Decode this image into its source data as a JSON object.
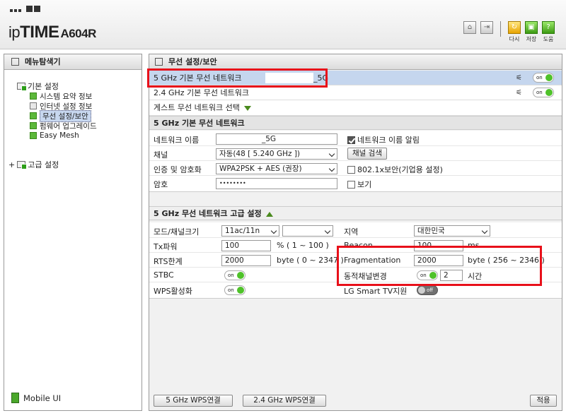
{
  "header": {
    "brand_ip": "ip",
    "brand_time": "TIME",
    "brand_model": "A604R",
    "icons": [
      {
        "name": "home-icon",
        "glyph": "⌂"
      },
      {
        "name": "logout-icon",
        "glyph": "⇥"
      }
    ],
    "actions": [
      {
        "name": "restart-button",
        "label": "다시",
        "glyph": "↻",
        "color": "#e8a400"
      },
      {
        "name": "save-button",
        "label": "저장",
        "glyph": "▣",
        "color": "#3c9b12"
      },
      {
        "name": "help-button",
        "label": "도움",
        "glyph": "?",
        "color": "#3c9b12"
      }
    ]
  },
  "sidebar": {
    "title": "메뉴탐색기",
    "basic_label": "기본 설정",
    "basic_items": [
      {
        "label": "시스템 요약 정보"
      },
      {
        "label": "인터넷 설정 정보"
      },
      {
        "label": "무선 설정/보안"
      },
      {
        "label": "펌웨어 업그레이드"
      },
      {
        "label": "Easy Mesh"
      }
    ],
    "advanced_label": "고급 설정",
    "mobile_label": "Mobile UI"
  },
  "main": {
    "title": "무선 설정/보안",
    "networks": [
      {
        "label": "5 GHz 기본 무선 네트워크",
        "suffix": "_5G",
        "toggle": "on"
      },
      {
        "label": "2.4 GHz 기본 무선 네트워크",
        "suffix": "",
        "toggle": "on"
      }
    ],
    "guest_label": "게스트 무선 네트워크 선택",
    "basic_section": {
      "title": "5 GHz 기본 무선 네트워크",
      "name_label": "네트워크 이름",
      "name_value": "_5G",
      "broadcast_label": "네트워크 이름 알림",
      "channel_label": "채널",
      "channel_value": "자동(48 [ 5.240 GHz ])",
      "channel_search": "채널 검색",
      "auth_label": "인증 및 암호화",
      "auth_value": "WPA2PSK + AES (권장)",
      "dot1x_label": "802.1x보안(기업용 설정)",
      "password_label": "암호",
      "password_value": "••••••••",
      "show_label": "보기"
    },
    "adv_section": {
      "title": "5 GHz 무선 네트워크 고급 설정",
      "mode_label": "모드/채널크기",
      "mode_value": "11ac/11n",
      "width_value": "",
      "region_label": "지역",
      "region_value": "대한민국",
      "tx_label": "Tx파워",
      "tx_value": "100",
      "tx_unit": "% ( 1 ~ 100 )",
      "beacon_label": "Beacon",
      "beacon_value": "100",
      "beacon_unit": "ms",
      "rts_label": "RTS한계",
      "rts_value": "2000",
      "rts_unit": "byte ( 0 ~ 2347 )",
      "frag_label": "Fragmentation",
      "frag_value": "2000",
      "frag_unit": "byte ( 256 ~ 2346 )",
      "stbc_label": "STBC",
      "dyn_label": "동적채널변경",
      "dyn_value": "2",
      "dyn_unit": "시간",
      "wps_label": "WPS활성화",
      "lg_label": "LG Smart TV지원"
    },
    "toggle_on": "on",
    "toggle_off": "off",
    "buttons": {
      "wps5": "5 GHz WPS연결",
      "wps24": "2.4 GHz WPS연결",
      "apply": "적용"
    }
  },
  "colors": {
    "highlight": "#e8101a",
    "selected_row": "#c5d6ee",
    "toggle_on": "#4fc22a"
  }
}
